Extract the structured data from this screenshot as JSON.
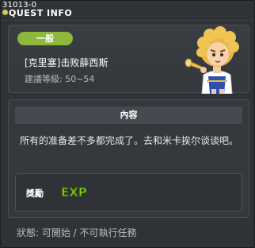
{
  "window": {
    "quest_id": "31013-0",
    "title": "QUEST INFO",
    "icon": "info-dot-icon"
  },
  "quest": {
    "category": "一般",
    "name": "[克里塞]击败薛西斯",
    "level": "建議等級: 50~54",
    "npc_icon": "npc-portrait-icon"
  },
  "content": {
    "header": "內容",
    "text": "所有的准备差不多都完成了。去和米卡挨尔谈谈吧。"
  },
  "reward": {
    "label": "獎勵",
    "exp_text": "EXP",
    "exp_icon": "exp-icon",
    "exp_color": "#8ed61b"
  },
  "status": {
    "text": "狀態: 可開始 / 不可執行任務"
  },
  "colors": {
    "badge": "#8db83c",
    "background": "#2f3236",
    "text": "#ffffff"
  }
}
